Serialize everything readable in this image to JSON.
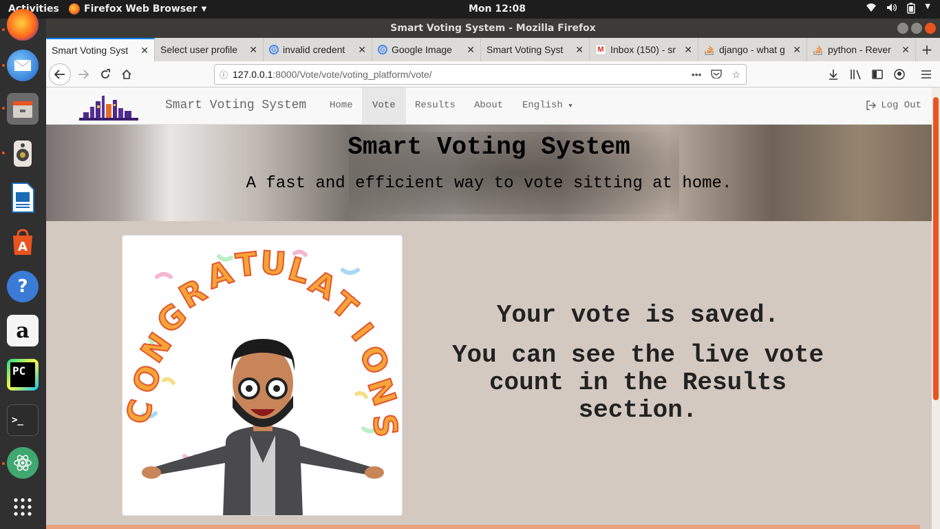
{
  "topbar": {
    "activities": "Activities",
    "app_name": "Firefox Web Browser",
    "clock": "Mon 12:08"
  },
  "dock": {
    "items": [
      "firefox-icon",
      "thunderbird-icon",
      "files-icon",
      "rhythmbox-icon",
      "writer-icon",
      "software-center-icon",
      "help-icon",
      "amazon-icon",
      "pycharm-icon",
      "terminal-icon",
      "atom-icon",
      "show-apps-icon"
    ]
  },
  "window": {
    "title": "Smart Voting System - Mozilla Firefox"
  },
  "tabs": [
    {
      "label": "Smart Voting Syst",
      "icon": "none",
      "active": true
    },
    {
      "label": "Select user profile",
      "icon": "none",
      "active": false
    },
    {
      "label": "invalid credent",
      "icon": "google",
      "active": false
    },
    {
      "label": "Google Image",
      "icon": "google",
      "active": false
    },
    {
      "label": "Smart Voting Syst",
      "icon": "none",
      "active": false
    },
    {
      "label": "Inbox (150) - sr",
      "icon": "gmail",
      "active": false
    },
    {
      "label": "django - what g",
      "icon": "stackoverflow",
      "active": false
    },
    {
      "label": "python - Rever",
      "icon": "stackoverflow",
      "active": false
    }
  ],
  "urlbar": {
    "host": "127.0.0.1",
    "path": ":8000/Vote/vote/voting_platform/vote/"
  },
  "site": {
    "brand": "Smart Voting System",
    "nav": {
      "home": "Home",
      "vote": "Vote",
      "results": "Results",
      "about": "About",
      "language": "English"
    },
    "logout": "Log Out",
    "hero_title": "Smart Voting System",
    "hero_subtitle": "A fast and efficient way to vote sitting at home.",
    "image_text": "CONGRATULATIONS",
    "message_line1": "Your vote is saved.",
    "message_line2": "You can see the live vote count in the Results section."
  },
  "colors": {
    "ubuntu_orange": "#e95420",
    "page_bg": "#d3c9c1",
    "active_tab_accent": "#0a84ff"
  }
}
